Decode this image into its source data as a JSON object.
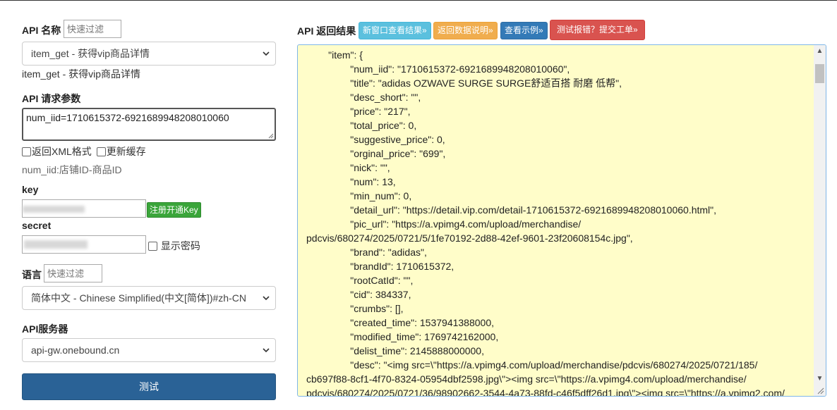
{
  "left": {
    "api_name_label": "API 名称",
    "api_name_filter_placeholder": "快速过滤",
    "api_select_value": "item_get - 获得vip商品详情",
    "api_desc": "item_get - 获得vip商品详情",
    "params_label": "API 请求参数",
    "params_value": "num_iid=1710615372-6921689948208010060",
    "opt_xml": "返回XML格式",
    "opt_cache": "更新缓存",
    "param_hint": "num_iid:店铺ID-商品ID",
    "key_label": "key",
    "register_btn": "注册开通Key",
    "secret_label": "secret",
    "show_password": "显示密码",
    "lang_label": "语言",
    "lang_filter_placeholder": "快速过滤",
    "lang_select_value": "简体中文 - Chinese Simplified(中文[简体])#zh-CN",
    "server_label": "API服务器",
    "server_select_value": "api-gw.onebound.cn",
    "test_btn": "测试"
  },
  "right": {
    "result_label": "API 返回结果",
    "btn_new_window": "新窗口查看结果»",
    "btn_data_doc": "返回数据说明»",
    "btn_example": "查看示例»",
    "btn_report": "测试报错？提交工单»",
    "colors": {
      "new_window": "#5bc0de",
      "data_doc": "#f0ad4e",
      "example": "#337ab7",
      "report": "#d9534f"
    },
    "result_text": "        \"item\": {\n                \"num_iid\": \"1710615372-6921689948208010060\",\n                \"title\": \"adidas OZWAVE SURGE SURGE舒适百搭 耐磨 低帮\",\n                \"desc_short\": \"\",\n                \"price\": \"217\",\n                \"total_price\": 0,\n                \"suggestive_price\": 0,\n                \"orginal_price\": \"699\",\n                \"nick\": \"\",\n                \"num\": 13,\n                \"min_num\": 0,\n                \"detail_url\": \"https://detail.vip.com/detail-1710615372-6921689948208010060.html\",\n                \"pic_url\": \"https://a.vpimg4.com/upload/merchandise/\npdcvis/680274/2025/0721/5/1fe70192-2d88-42ef-9601-23f20608154c.jpg\",\n                \"brand\": \"adidas\",\n                \"brandId\": 1710615372,\n                \"rootCatId\": \"\",\n                \"cid\": 384337,\n                \"crumbs\": [],\n                \"created_time\": 1537941388000,\n                \"modified_time\": 1769742162000,\n                \"delist_time\": 2145888000000,\n                \"desc\": \"<img src=\\\"https://a.vpimg4.com/upload/merchandise/pdcvis/680274/2025/0721/185/\ncb697f88-8cf1-4f70-8324-05954dbf2598.jpg\\\"><img src=\\\"https://a.vpimg4.com/upload/merchandise/\npdcvis/680274/2025/0721/36/98902662-3544-4a73-88fd-c46f5dff26d1.jpg\\\"><img src=\\\"https://a.vpimg2.com/"
  }
}
